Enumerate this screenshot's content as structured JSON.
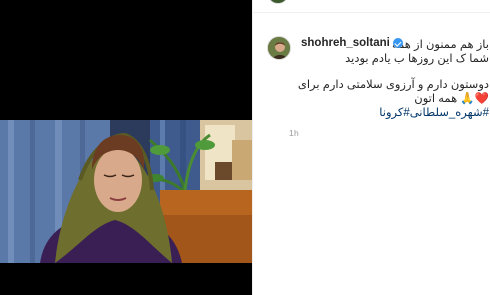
{
  "post": {
    "user": {
      "username": "shohreh_soltani",
      "verified": true
    },
    "caption": {
      "line1": "باز هم ممنون از همه",
      "line2": "شما ک این روزها ب یادم بودید",
      "line3": "دوستون دارم و آرزوی سلامتی دارم برای",
      "line4_text": " همه اتون",
      "line4_emoji_heart": "❤️",
      "line4_emoji_pray": "🙏",
      "hashtags": "#شهره_سلطانی#کرونا"
    },
    "time_ago": "1h"
  },
  "colors": {
    "verified": "#3897f0",
    "hashtag": "#003569",
    "timestamp": "#999999"
  },
  "icons": [
    "verified-badge-icon"
  ]
}
